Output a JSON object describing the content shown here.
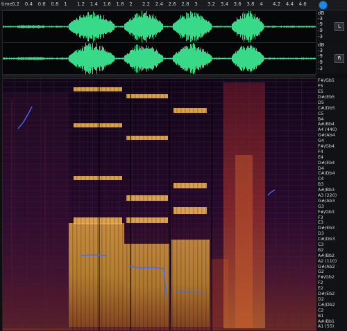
{
  "ruler": {
    "unit": "time",
    "ticks": [
      "0.2",
      "0.4",
      "0.6",
      "0.8",
      "1",
      "1.2",
      "1.4",
      "1.6",
      "1.8",
      "2",
      "2.2",
      "2.4",
      "2.6",
      "2.8",
      "3",
      "3.2",
      "3.4",
      "3.6",
      "3.8",
      "4",
      "4.2",
      "4.4",
      "4.6"
    ]
  },
  "channels": [
    {
      "scale": [
        "dB",
        "-3",
        "-9",
        "-9",
        "-3"
      ],
      "badge": "L"
    },
    {
      "scale": [
        "dB",
        "-3",
        "-9",
        "-9",
        "-3"
      ],
      "badge": "R"
    }
  ],
  "notes": [
    "F#/Gb5",
    "F5",
    "E5",
    "D#/Eb5",
    "D5",
    "C#/Db5",
    "C5",
    "B4",
    "A#/Bb4",
    "A4 (440)",
    "G#/Ab4",
    "G4",
    "F#/Gb4",
    "F4",
    "E4",
    "D#/Eb4",
    "D4",
    "C#/Db4",
    "C4",
    "B3",
    "A#/Bb3",
    "A3 (220)",
    "G#/Ab3",
    "G3",
    "F#/Gb3",
    "F3",
    "E3",
    "D#/Eb3",
    "D3",
    "C#/Db3",
    "C3",
    "B2",
    "A#/Bb2",
    "A2 (110)",
    "G#/Ab2",
    "G2",
    "F#/Gb2",
    "F2",
    "E2",
    "D#/Eb2",
    "D2",
    "C#/Db2",
    "C2",
    "B1",
    "A#/Bb1",
    "A1 (55)"
  ],
  "colors": {
    "waveform": "#39d98a",
    "pitch_line": "#3f6bff",
    "accent": "#1e88e5"
  }
}
